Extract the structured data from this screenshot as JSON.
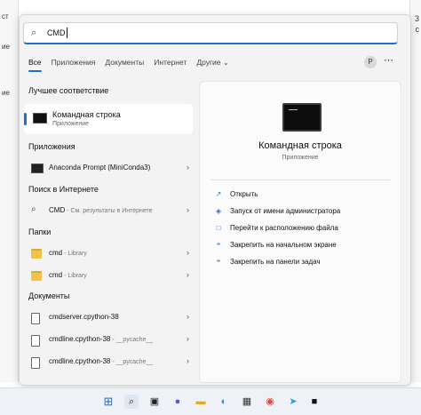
{
  "search": {
    "value": "CMD"
  },
  "tabs": [
    {
      "label": "Все"
    },
    {
      "label": "Приложения"
    },
    {
      "label": "Документы"
    },
    {
      "label": "Интернет"
    },
    {
      "label": "Другие"
    }
  ],
  "user_initial": "P",
  "best_match": {
    "header": "Лучшее соответствие",
    "name": "Командная строка",
    "sub": "Приложение"
  },
  "apps": {
    "header": "Приложения",
    "items": [
      {
        "label": "Anaconda Prompt (MiniConda3)"
      }
    ]
  },
  "web": {
    "header": "Поиск в Интернете",
    "items": [
      {
        "label": "CMD",
        "suffix": " - См. результаты в Интернете"
      }
    ]
  },
  "folders": {
    "header": "Папки",
    "items": [
      {
        "label": "cmd",
        "suffix": " - Library"
      },
      {
        "label": "cmd",
        "suffix": " - Library"
      }
    ]
  },
  "documents": {
    "header": "Документы",
    "items": [
      {
        "label": "cmdserver.cpython-38",
        "suffix": ""
      },
      {
        "label": "cmdline.cpython-38",
        "suffix": " - __pycache__"
      },
      {
        "label": "cmdline.cpython-38",
        "suffix": " - __pycache__"
      }
    ]
  },
  "preview": {
    "title": "Командная строка",
    "subtitle": "Приложение",
    "actions": [
      {
        "label": "Открыть",
        "icon": "open-icon"
      },
      {
        "label": "Запуск от имени администратора",
        "icon": "shield-icon"
      },
      {
        "label": "Перейти к расположению файла",
        "icon": "folder-open-icon"
      },
      {
        "label": "Закрепить на начальном экране",
        "icon": "pin-icon"
      },
      {
        "label": "Закрепить на панели задач",
        "icon": "pin-icon"
      }
    ]
  },
  "background_text": {
    "left": [
      "ст",
      "ие",
      "ие"
    ],
    "right": [
      "3",
      "с"
    ]
  },
  "colors": {
    "accent": "#1f6fc9",
    "panel": "#f3f3f3"
  }
}
